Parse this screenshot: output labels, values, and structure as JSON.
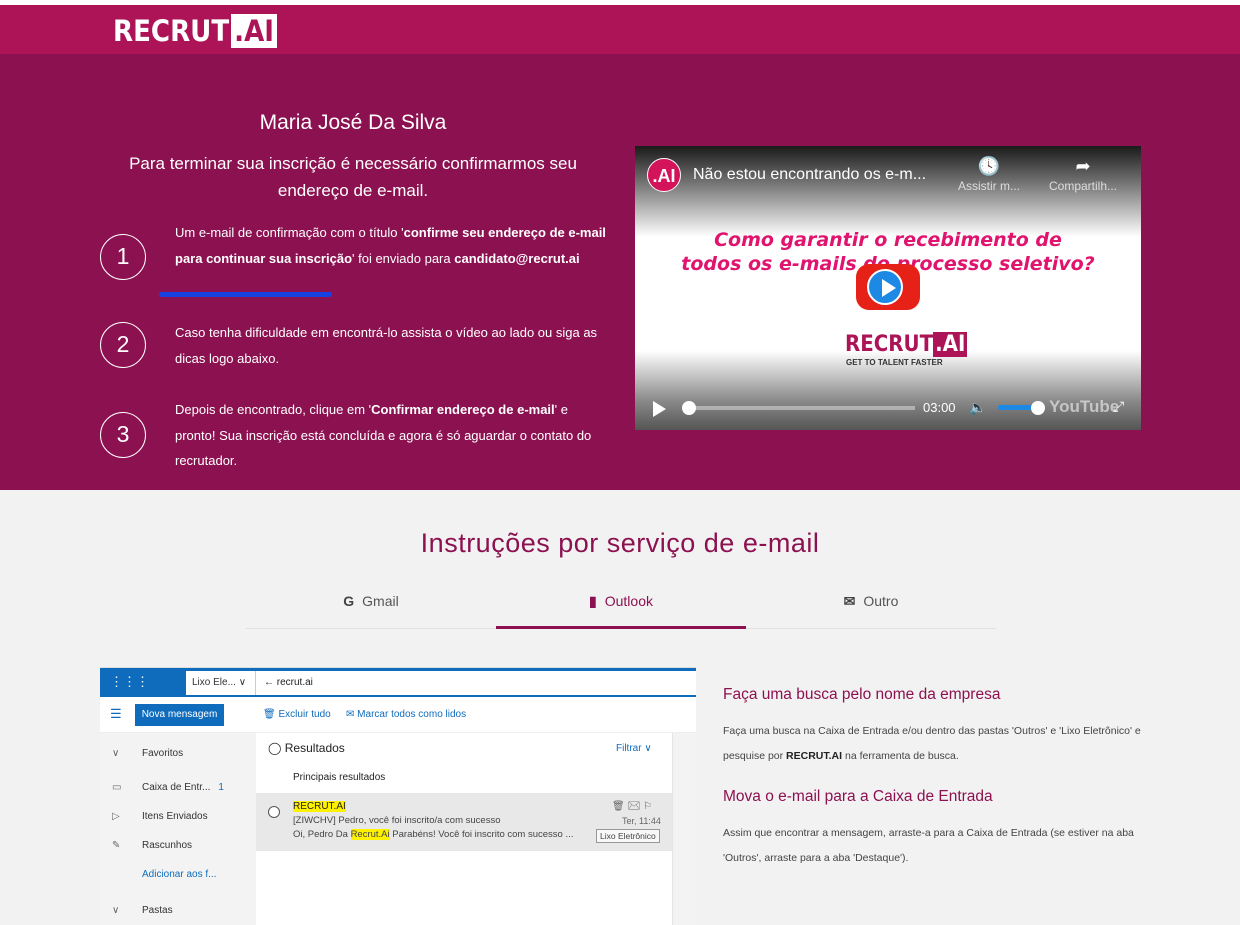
{
  "brand": {
    "name_prefix": "RECRUT",
    "name_suffix": ".AI"
  },
  "hero": {
    "name": "Maria José Da Silva",
    "subtitle": "Para terminar sua inscrição é necessário confirmarmos seu endereço de e-mail.",
    "steps": [
      {
        "number": "1",
        "text_a": "Um e-mail de confirmação com o título '",
        "text_b": "confirme seu endereço de e-mail para continuar sua inscrição",
        "text_c": "' foi enviado para ",
        "email": "candidato@recrut.ai"
      },
      {
        "number": "2",
        "text": "Caso tenha dificuldade em encontrá-lo assista o vídeo ao lado ou siga as dicas logo abaixo."
      },
      {
        "number": "3",
        "text_a": "Depois de encontrado, clique em '",
        "text_b": "Confirmar endereço de e-mail",
        "text_c": "' e pronto! Sua inscrição está concluída e agora é só aguardar o contato do recrutador."
      }
    ]
  },
  "video": {
    "channel_avatar": ".AI",
    "title": "Não estou encontrando os e-m...",
    "watch_later": "Assistir m...",
    "share": "Compartilh...",
    "headline_1": "Como garantir o recebimento de",
    "headline_2": "todos os e-mails do processo seletivo?",
    "logo_prefix": "RECRUT",
    "logo_suffix": ".AI",
    "tagline": "GET TO TALENT FASTER",
    "time": "03:00",
    "youtube": "YouTube",
    "icons": {
      "clock": "clock-icon",
      "share": "share-icon",
      "play": "play-icon",
      "volume": "volume-icon",
      "fullscreen": "fullscreen-icon"
    }
  },
  "instructions": {
    "title": "Instruções por serviço de e-mail",
    "tabs": [
      {
        "icon": "G",
        "label": "Gmail",
        "active": false
      },
      {
        "icon": "▮",
        "label": "Outlook",
        "active": true
      },
      {
        "icon": "✉",
        "label": "Outro",
        "active": false
      }
    ]
  },
  "outlook": {
    "folder_box": "Lixo Ele...  ∨",
    "search_text": "←   recrut.ai",
    "new_message": "Nova mensagem",
    "delete_all": "Excluir tudo",
    "mark_read": "Marcar todos como lidos",
    "nav": {
      "favorites": "Favoritos",
      "inbox": "Caixa de Entr...",
      "inbox_count": "1",
      "sent": "Itens Enviados",
      "drafts": "Rascunhos",
      "add_fav": "Adicionar aos f...",
      "folders": "Pastas"
    },
    "results": "Resultados",
    "filter": "Filtrar ∨",
    "top_results": "Principais resultados",
    "message": {
      "sender": "RECRUT.AI",
      "subject": "[ZIWCHV] Pedro, você foi inscrito/a com sucesso",
      "preview_a": "Oi, Pedro Da ",
      "preview_hl": "Recrut.Ai",
      "preview_b": " Parabéns! Você foi inscrito com sucesso ...",
      "date": "Ter, 11:44",
      "folder": "Lixo Eletrônico"
    }
  },
  "tips": [
    {
      "title": "Faça uma busca pelo nome da empresa",
      "text_a": "Faça uma busca na Caixa de Entrada e/ou dentro das pastas 'Outros' e 'Lixo Eletrônico' e pesquise por ",
      "text_b": "RECRUT.AI",
      "text_c": " na ferramenta de busca."
    },
    {
      "title": "Mova o e-mail para a Caixa de Entrada",
      "text": "Assim que encontrar a mensagem, arraste-a para a Caixa de Entrada (se estiver na aba 'Outros', arraste para a aba 'Destaque')."
    }
  ],
  "colors": {
    "brand": "#ad1457",
    "hero": "#8c1150",
    "outlook": "#0f6cbd",
    "highlight": "#fff200",
    "underline": "#1741e0"
  }
}
